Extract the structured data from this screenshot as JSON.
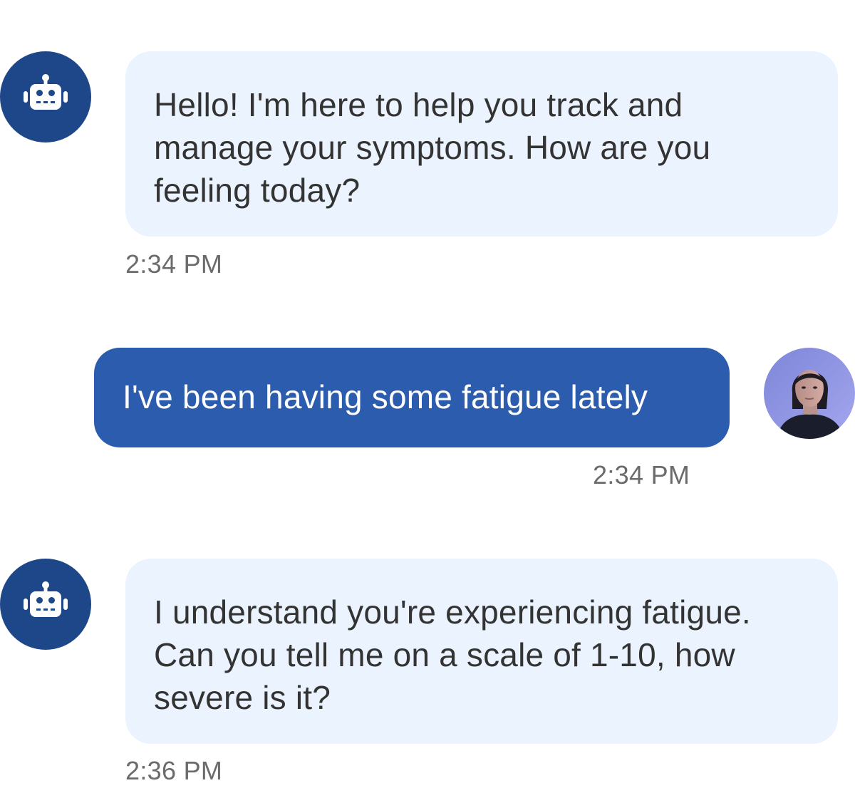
{
  "messages": [
    {
      "sender": "bot",
      "avatar_icon": "robot-icon",
      "text": "Hello! I'm here to help you track and manage your symptoms. How are you feeling today?",
      "time": "2:34 PM"
    },
    {
      "sender": "user",
      "avatar_icon": "user-avatar",
      "text": "I've been having some fatigue lately",
      "time": "2:34 PM"
    },
    {
      "sender": "bot",
      "avatar_icon": "robot-icon",
      "text": "I understand you're experiencing fatigue. Can you tell me on a scale of 1-10, how severe is it?",
      "time": "2:36 PM"
    }
  ],
  "colors": {
    "bot_avatar_bg": "#1d4788",
    "bot_bubble_bg": "#ebf3fe",
    "user_bubble_bg": "#2b5cad",
    "timestamp": "#6b6b6b"
  }
}
